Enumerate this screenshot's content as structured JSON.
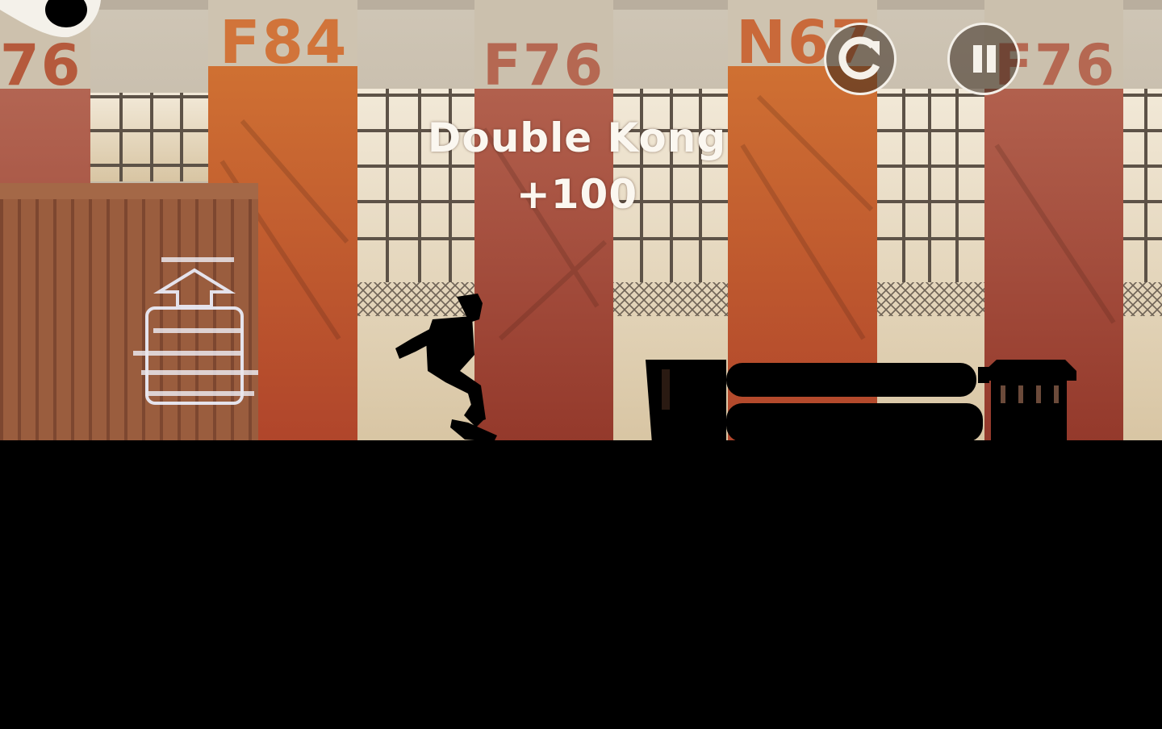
{
  "hud": {
    "trick_name": "Double Kong",
    "trick_points": "+100",
    "restart_icon": "restart-icon",
    "pause_icon": "pause-icon",
    "eye_icon": "eye-icon"
  },
  "scene": {
    "building_labels": [
      "76",
      "F84",
      "F76",
      "N67",
      "F76"
    ],
    "colors": {
      "sky": "#d9ccb6",
      "orange_pillar": "#c8692f",
      "red_pillar": "#a2422c",
      "silhouette": "#000000",
      "ui_white": "#f5f1ea"
    }
  }
}
